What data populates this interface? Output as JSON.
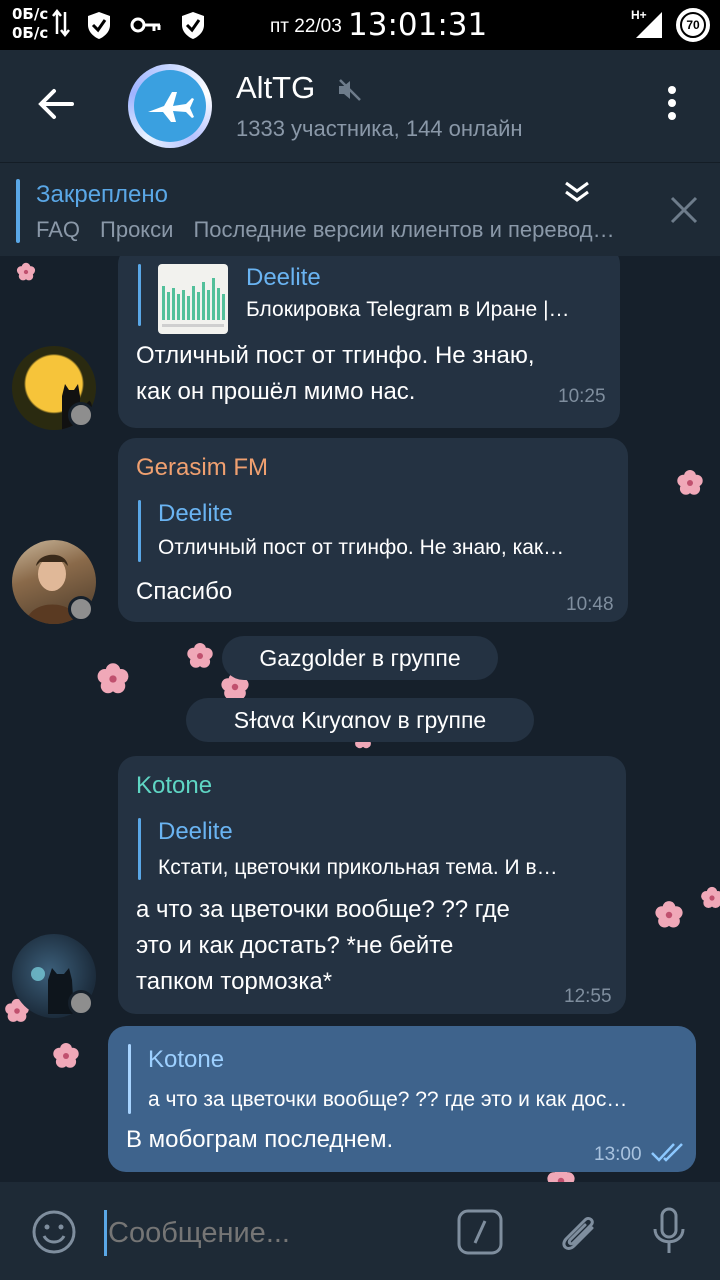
{
  "status_bar": {
    "speed_up": "0Б/с",
    "speed_down": "0Б/с",
    "date": "пт 22/03",
    "time": "13:01:31",
    "network": "H+",
    "battery": "70"
  },
  "header": {
    "title": "AltTG",
    "subtitle": "1333 участника, 144 онлайн",
    "muted": true
  },
  "pinned": {
    "label": "Закреплено",
    "items": [
      "FAQ",
      "Прокси",
      "Последние версии клиентов и перевод…"
    ]
  },
  "messages": [
    {
      "reply_name": "Deelite",
      "reply_text": "Блокировка Telegram в Иране |…",
      "text_lines": [
        "Отличный пост от тгинфо. Не знаю,",
        "как он прошёл мимо нас."
      ],
      "time": "10:25"
    },
    {
      "sender": "Gerasim FM",
      "reply_name": "Deelite",
      "reply_text": "Отличный пост от тгинфо. Не знаю, как…",
      "text_lines": [
        "Спасибо"
      ],
      "time": "10:48"
    },
    {
      "sender": "Kotone",
      "reply_name": "Deelite",
      "reply_text": "Кстати, цветочки прикольная тема. И в…",
      "text_lines": [
        "а что за цветочки вообще? ?? где",
        "это и как достать? *не бейте",
        "тапком тормозка*"
      ],
      "time": "12:55"
    },
    {
      "reply_name": "Kotone",
      "reply_text": "а что за цветочки вообще? ?? где это и как дос…",
      "text_lines": [
        "В мобограм последнем."
      ],
      "time": "13:00"
    }
  ],
  "service_messages": [
    "Gazgolder в группе",
    "Sɫαvα Kɩryαnov в группе"
  ],
  "colors": {
    "accent": "#5aa7e6",
    "gerasim": "#f0a070",
    "kotone": "#5fd6c4",
    "bubble_in": "#243242",
    "bubble_out": "#3e638c"
  },
  "input": {
    "placeholder": "Сообщение..."
  }
}
